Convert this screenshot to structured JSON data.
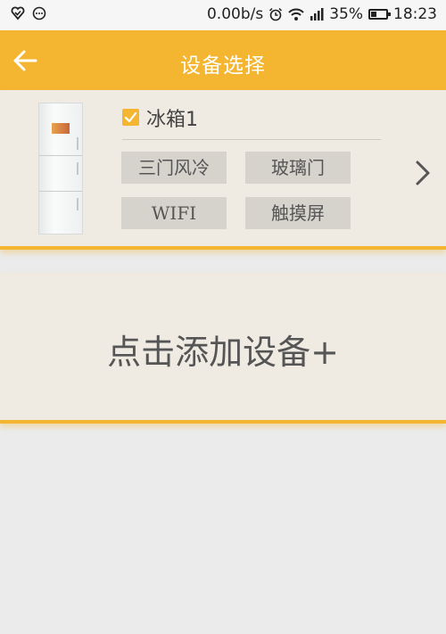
{
  "status_bar": {
    "speed": "0.00b/s",
    "battery": "35%",
    "battery_level": 0.35,
    "time": "18:23",
    "icons": [
      "heart-check-icon",
      "chat-icon",
      "alarm-icon",
      "wifi-icon",
      "signal-icon",
      "battery-icon"
    ]
  },
  "header": {
    "title": "设备选择",
    "back_icon": "arrow-left-icon",
    "background": "#f4b531"
  },
  "device": {
    "name": "冰箱1",
    "checked": true,
    "tags": [
      "三门风冷",
      "玻璃门",
      "WIFI",
      "触摸屏"
    ],
    "more_icon": "chevron-right-icon"
  },
  "add_device": {
    "label": "点击添加设备+"
  },
  "colors": {
    "accent": "#f4b531",
    "card": "#efebe3",
    "page": "#ebebeb",
    "tag": "#d6d3cd"
  }
}
